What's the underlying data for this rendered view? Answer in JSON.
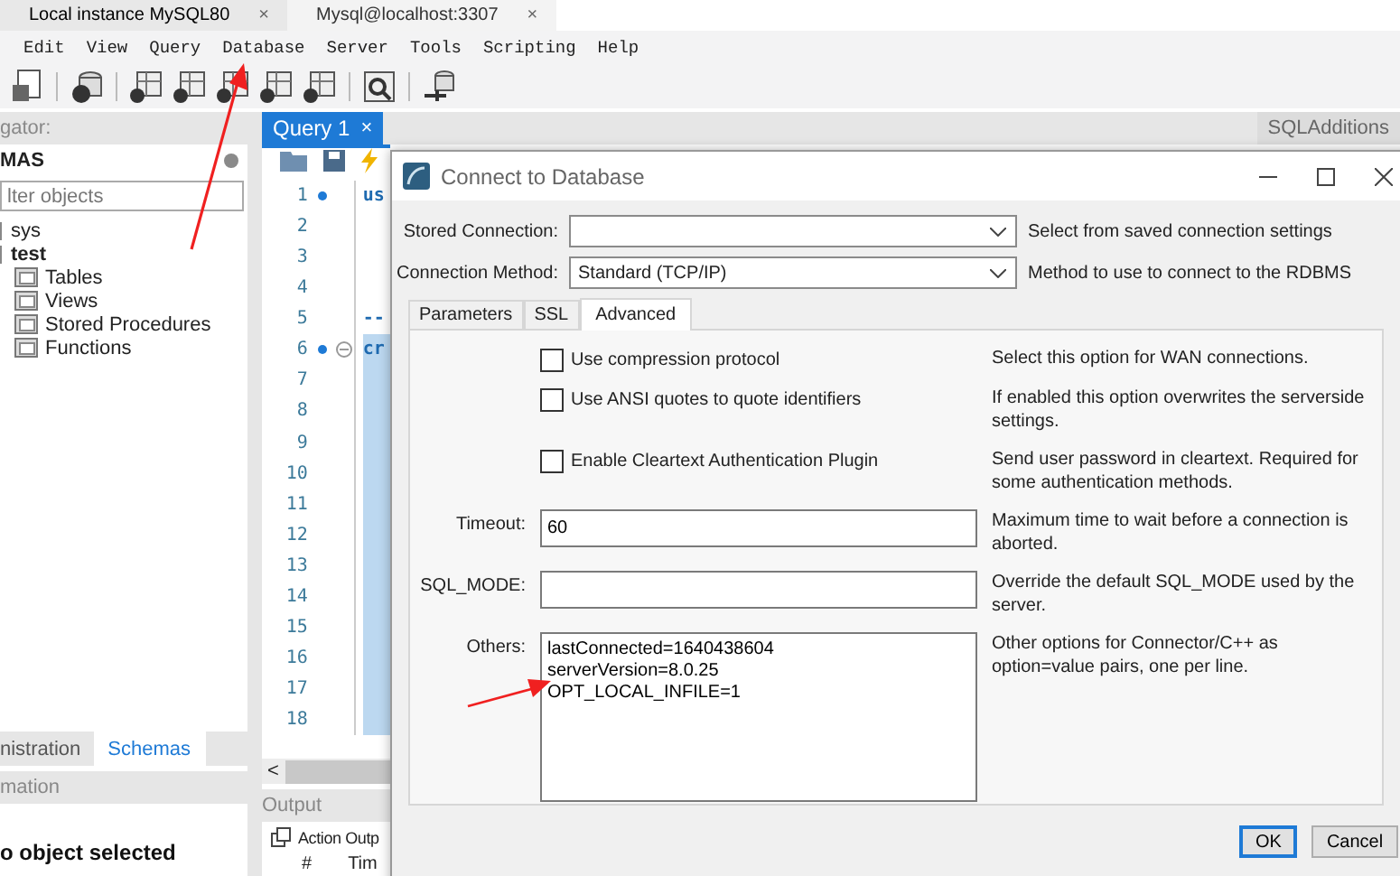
{
  "app_tabs": [
    {
      "label": "Local instance MySQL80",
      "close": "×",
      "selected": true
    },
    {
      "label": "Mysql@localhost:3307",
      "close": "×",
      "selected": false
    }
  ],
  "menu": [
    "Edit",
    "View",
    "Query",
    "Database",
    "Server",
    "Tools",
    "Scripting",
    "Help"
  ],
  "navigator": {
    "title": "gator:",
    "section": "MAS",
    "filter_placeholder": "lter objects",
    "schemas": [
      {
        "name": "sys",
        "active": false
      },
      {
        "name": "test",
        "active": true,
        "children": [
          "Tables",
          "Views",
          "Stored Procedures",
          "Functions"
        ]
      }
    ]
  },
  "navigator_tabs": [
    {
      "label": "nistration",
      "selected": false
    },
    {
      "label": "Schemas",
      "selected": true
    }
  ],
  "information": {
    "title": "mation",
    "text": "o object selected"
  },
  "query_tab": {
    "label": "Query 1",
    "close": "×"
  },
  "side_tab": "SQLAdditions",
  "editor": {
    "lines": [
      {
        "number": "1",
        "text": "us",
        "marker": true,
        "fold": false,
        "selected": false
      },
      {
        "number": "2",
        "marker": false,
        "fold": false,
        "selected": false
      },
      {
        "number": "3",
        "marker": false,
        "fold": false,
        "selected": false
      },
      {
        "number": "4",
        "marker": false,
        "fold": false,
        "selected": false
      },
      {
        "number": "5",
        "text": "--",
        "marker": false,
        "fold": false,
        "selected": false
      },
      {
        "number": "6",
        "text": "cr",
        "marker": true,
        "fold": true,
        "selected": true
      },
      {
        "number": "7",
        "marker": false,
        "fold": false,
        "selected": true
      },
      {
        "number": "8",
        "marker": false,
        "fold": false,
        "selected": true
      },
      {
        "number": "9",
        "marker": false,
        "fold": false,
        "selected": true
      },
      {
        "number": "10",
        "marker": false,
        "fold": false,
        "selected": true
      },
      {
        "number": "11",
        "marker": false,
        "fold": false,
        "selected": true
      },
      {
        "number": "12",
        "marker": false,
        "fold": false,
        "selected": true
      },
      {
        "number": "13",
        "marker": false,
        "fold": false,
        "selected": true
      },
      {
        "number": "14",
        "marker": false,
        "fold": false,
        "selected": true
      },
      {
        "number": "15",
        "marker": false,
        "fold": false,
        "selected": true
      },
      {
        "number": "16",
        "marker": false,
        "fold": false,
        "selected": true
      },
      {
        "number": "17",
        "marker": false,
        "fold": false,
        "selected": true
      },
      {
        "number": "18",
        "marker": false,
        "fold": false,
        "selected": true
      }
    ],
    "scroll_left": "<"
  },
  "output": {
    "title": "Output",
    "selector": "Action Outp",
    "columns": [
      "#",
      "Tim"
    ]
  },
  "dialog": {
    "title": "Connect to Database",
    "fields": [
      {
        "label": "Stored Connection:",
        "hint": "Select from saved connection settings"
      },
      {
        "label": "Connection Method:",
        "value": "Standard (TCP/IP)",
        "hint": "Method to use to connect to the RDBMS"
      }
    ],
    "tabs": [
      {
        "label": "Parameters",
        "selected": false
      },
      {
        "label": "SSL",
        "selected": false
      },
      {
        "label": "Advanced",
        "selected": true
      }
    ],
    "options": [
      {
        "label": "Use compression protocol",
        "checked": false,
        "hint": "Select this option for WAN connections."
      },
      {
        "label": "Use ANSI quotes to quote identifiers",
        "checked": false,
        "hint": "If enabled this option overwrites the serverside settings."
      },
      {
        "label": "Enable Cleartext Authentication Plugin",
        "checked": false,
        "hint": "Send user password in cleartext. Required for some authentication methods."
      }
    ],
    "inputs": [
      {
        "label": "Timeout:",
        "value": "60",
        "hint": "Maximum time to wait before a connection is aborted."
      },
      {
        "label": "SQL_MODE:",
        "hint": "Override the default SQL_MODE used by the server."
      }
    ],
    "others": {
      "label": "Others:",
      "lines": [
        "lastConnected=1640438604",
        "serverVersion=8.0.25",
        "OPT_LOCAL_INFILE=1"
      ],
      "hint": "Other options for Connector/C++ as option=value pairs, one per line."
    },
    "buttons": [
      {
        "label": "OK",
        "default": true
      },
      {
        "label": "Cancel",
        "default": false
      }
    ]
  }
}
